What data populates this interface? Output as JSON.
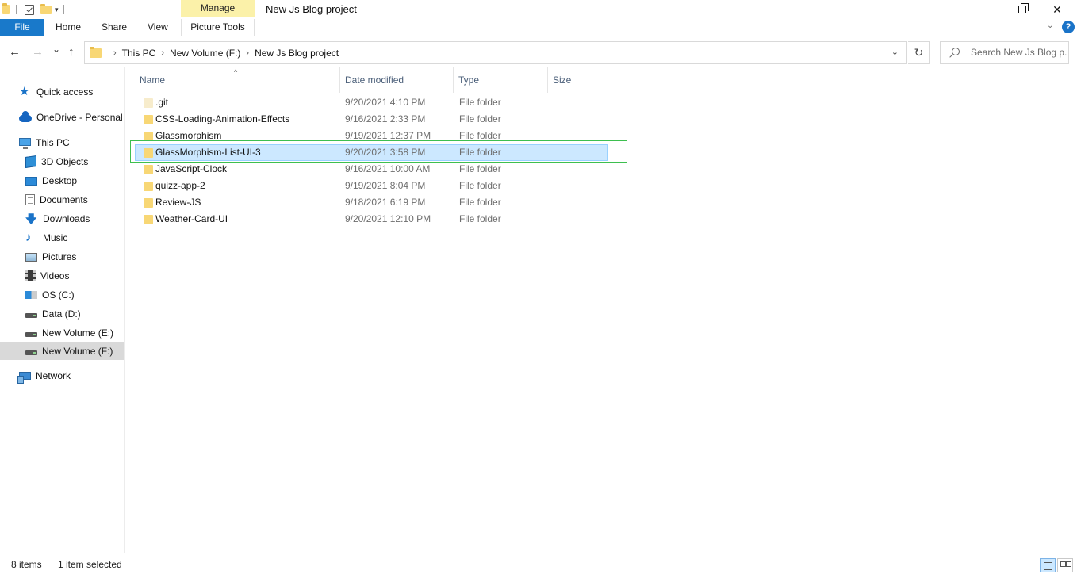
{
  "window": {
    "title": "New Js Blog project",
    "context_tab_group": "Manage",
    "minimize_glyph": "—",
    "close_glyph": "✕"
  },
  "ribbon": {
    "tabs": [
      {
        "label": "File"
      },
      {
        "label": "Home"
      },
      {
        "label": "Share"
      },
      {
        "label": "View"
      },
      {
        "label": "Picture Tools"
      }
    ],
    "help_label": "?",
    "accent_color": "#1979ca",
    "context_color": "#fbf1a9"
  },
  "nav": {
    "back_glyph": "←",
    "forward_glyph": "→",
    "recent_glyph": "⌄",
    "up_glyph": "↑",
    "refresh_glyph": "↻",
    "dropdown_glyph": "⌄",
    "breadcrumb": [
      "This PC",
      "New Volume (F:)",
      "New Js Blog project"
    ],
    "crumb_separator": "›",
    "search_placeholder": "Search New Js Blog p..."
  },
  "sidebar": {
    "items": [
      {
        "label": "Quick access",
        "icon": "star-icon"
      },
      {
        "label": "OneDrive - Personal",
        "icon": "cloud-icon"
      },
      {
        "label": "This PC",
        "icon": "computer-icon"
      },
      {
        "label": "3D Objects",
        "icon": "cube-icon"
      },
      {
        "label": "Desktop",
        "icon": "desktop-icon"
      },
      {
        "label": "Documents",
        "icon": "documents-icon"
      },
      {
        "label": "Downloads",
        "icon": "download-arrow-icon"
      },
      {
        "label": "Music",
        "icon": "music-note-icon"
      },
      {
        "label": "Pictures",
        "icon": "pictures-icon"
      },
      {
        "label": "Videos",
        "icon": "film-icon"
      },
      {
        "label": "OS (C:)",
        "icon": "windows-drive-icon"
      },
      {
        "label": "Data (D:)",
        "icon": "drive-icon"
      },
      {
        "label": "New Volume (E:)",
        "icon": "drive-icon"
      },
      {
        "label": "New Volume (F:)",
        "icon": "drive-icon",
        "selected": true
      },
      {
        "label": "Network",
        "icon": "network-icon"
      }
    ],
    "star_glyph": "★",
    "download_glyph": "🡇",
    "music_glyph": "♪"
  },
  "file_list": {
    "columns": [
      {
        "label": "Name"
      },
      {
        "label": "Date modified"
      },
      {
        "label": "Type"
      },
      {
        "label": "Size"
      }
    ],
    "sort_indicator": "^",
    "rows": [
      {
        "name": ".git",
        "date": "9/20/2021 4:10 PM",
        "type": "File folder",
        "size": "",
        "hidden": true
      },
      {
        "name": "CSS-Loading-Animation-Effects",
        "date": "9/16/2021 2:33 PM",
        "type": "File folder",
        "size": ""
      },
      {
        "name": "Glassmorphism",
        "date": "9/19/2021 12:37 PM",
        "type": "File folder",
        "size": ""
      },
      {
        "name": "GlassMorphism-List-UI-3",
        "date": "9/20/2021 3:58 PM",
        "type": "File folder",
        "size": "",
        "selected": true
      },
      {
        "name": "JavaScript-Clock",
        "date": "9/16/2021 10:00 AM",
        "type": "File folder",
        "size": ""
      },
      {
        "name": "quizz-app-2",
        "date": "9/19/2021 8:04 PM",
        "type": "File folder",
        "size": ""
      },
      {
        "name": "Review-JS",
        "date": "9/18/2021 6:19 PM",
        "type": "File folder",
        "size": ""
      },
      {
        "name": "Weather-Card-UI",
        "date": "9/20/2021 12:10 PM",
        "type": "File folder",
        "size": ""
      }
    ],
    "selection_color": "#cce8ff",
    "highlight_box_color": "#3dbf4f"
  },
  "status": {
    "item_count": "8 items",
    "selection": "1 item selected"
  }
}
